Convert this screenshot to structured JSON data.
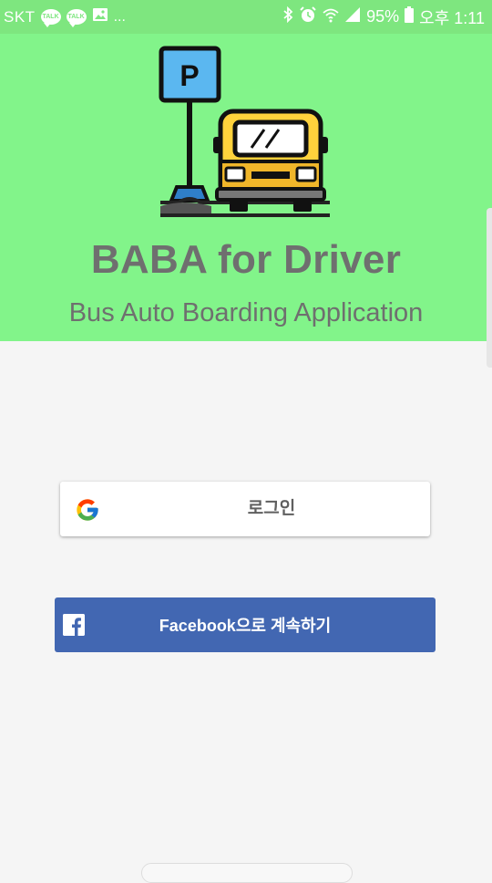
{
  "status_bar": {
    "carrier": "SKT",
    "notification_icons": [
      "talk-icon",
      "talk-icon",
      "image-icon"
    ],
    "talk_badge": "TALK",
    "overflow": "...",
    "battery_percent": "95%",
    "time": "오후 1:11"
  },
  "app": {
    "title": "BABA for Driver",
    "subtitle": "Bus Auto Boarding Application",
    "parking_sign_letter": "P"
  },
  "login": {
    "google_label": "로그인",
    "facebook_label": "Facebook으로 계속하기"
  },
  "colors": {
    "hero_background": "#82f48a",
    "status_bar": "#7ee67f",
    "facebook_blue": "#4267b2",
    "title_gray": "#6f6f6f"
  }
}
